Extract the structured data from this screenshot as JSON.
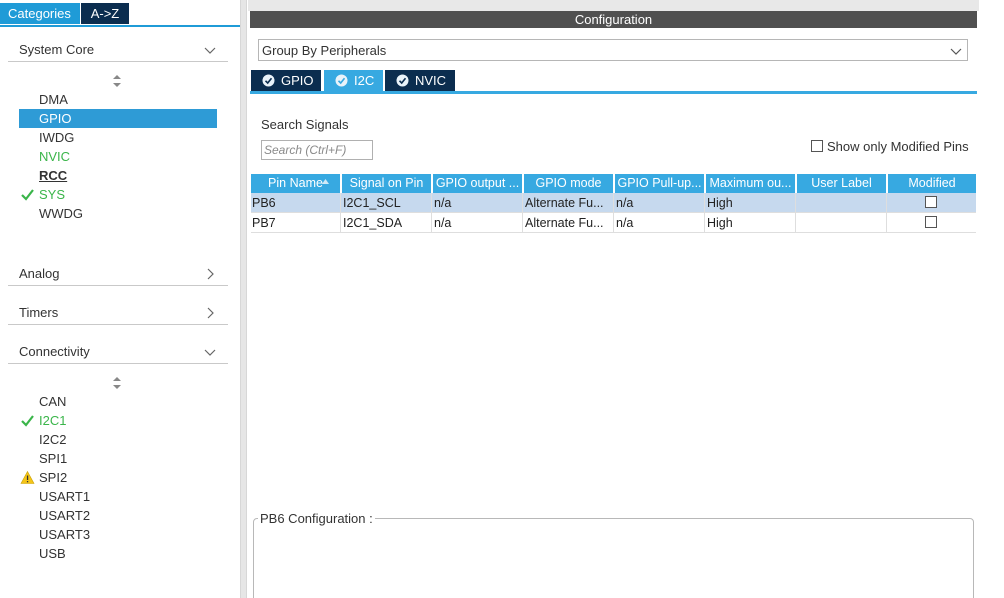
{
  "left_panel": {
    "tabs": [
      {
        "label": "Categories",
        "active": true
      },
      {
        "label": "A->Z",
        "active": false
      }
    ],
    "categories": [
      {
        "label": "System Core",
        "expanded": true
      },
      {
        "label": "Analog",
        "expanded": false
      },
      {
        "label": "Timers",
        "expanded": false
      },
      {
        "label": "Connectivity",
        "expanded": true
      }
    ],
    "system_core_items": [
      {
        "label": "DMA",
        "state": "normal"
      },
      {
        "label": "GPIO",
        "state": "selected"
      },
      {
        "label": "IWDG",
        "state": "normal"
      },
      {
        "label": "NVIC",
        "state": "green"
      },
      {
        "label": "RCC",
        "state": "bold"
      },
      {
        "label": "SYS",
        "state": "green-check"
      },
      {
        "label": "WWDG",
        "state": "normal"
      }
    ],
    "connectivity_items": [
      {
        "label": "CAN",
        "state": "normal"
      },
      {
        "label": "I2C1",
        "state": "green-check"
      },
      {
        "label": "I2C2",
        "state": "normal"
      },
      {
        "label": "SPI1",
        "state": "normal"
      },
      {
        "label": "SPI2",
        "state": "warning"
      },
      {
        "label": "USART1",
        "state": "normal"
      },
      {
        "label": "USART2",
        "state": "normal"
      },
      {
        "label": "USART3",
        "state": "normal"
      },
      {
        "label": "USB",
        "state": "normal"
      }
    ]
  },
  "config": {
    "title": "Configuration",
    "group_by": "Group By Peripherals",
    "peripheral_tabs": [
      {
        "label": "GPIO",
        "active": false
      },
      {
        "label": "I2C",
        "active": true
      },
      {
        "label": "NVIC",
        "active": false
      }
    ],
    "search_label": "Search Signals",
    "search_placeholder": "Search (Ctrl+F)",
    "show_modified_label": "Show only Modified Pins",
    "show_modified_checked": false,
    "columns": [
      "Pin Name",
      "Signal on Pin",
      "GPIO output ...",
      "GPIO mode",
      "GPIO Pull-up...",
      "Maximum ou...",
      "User Label",
      "Modified"
    ],
    "rows": [
      {
        "pin": "PB6",
        "signal": "I2C1_SCL",
        "output": "n/a",
        "mode": "Alternate Fu...",
        "pull": "n/a",
        "max": "High",
        "label": "",
        "modified": false,
        "selected": true
      },
      {
        "pin": "PB7",
        "signal": "I2C1_SDA",
        "output": "n/a",
        "mode": "Alternate Fu...",
        "pull": "n/a",
        "max": "High",
        "label": "",
        "modified": false,
        "selected": false
      }
    ],
    "pin_config_legend": "PB6 Configuration :"
  },
  "colors": {
    "accent": "#37a9e1",
    "dark_navy": "#0b2d4f",
    "selected_row": "#c6d9ee",
    "green": "#3ab54a",
    "warning": "#f5c518"
  }
}
